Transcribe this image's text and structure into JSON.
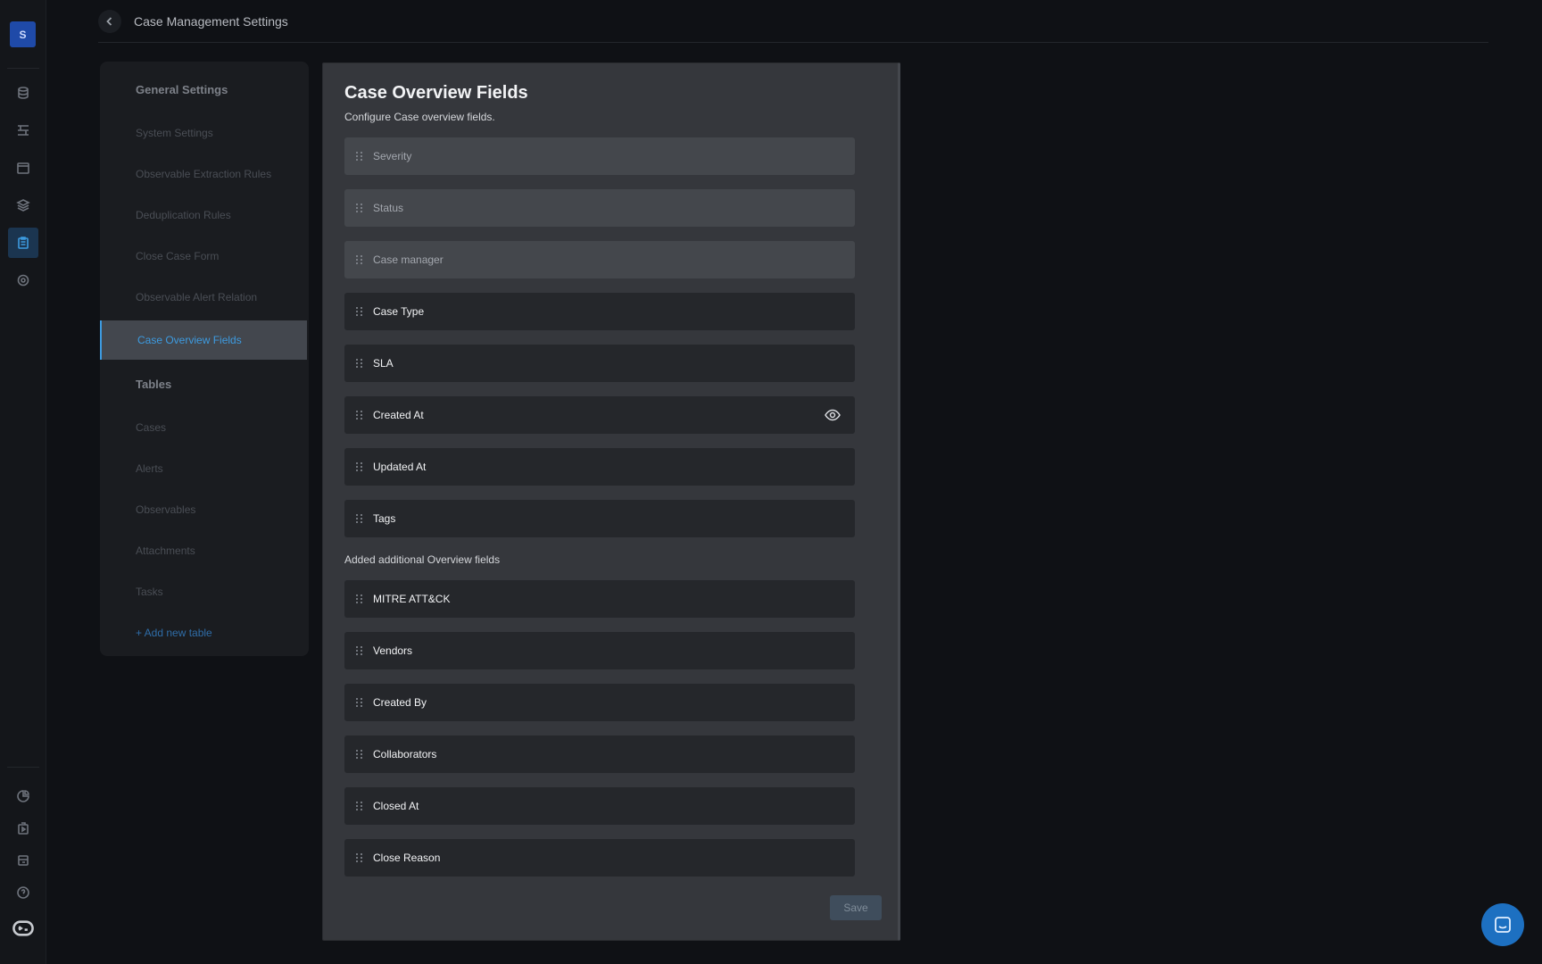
{
  "app": {
    "avatar_letter": "S",
    "accent_color": "#3d9be0"
  },
  "header": {
    "title": "Case Management Settings"
  },
  "nav": {
    "general_title": "General Settings",
    "general_items": [
      "System Settings",
      "Observable Extraction Rules",
      "Deduplication Rules",
      "Close Case Form",
      "Observable Alert Relation",
      "Case Overview Fields"
    ],
    "active_item": "Case Overview Fields",
    "tables_title": "Tables",
    "table_items": [
      "Cases",
      "Alerts",
      "Observables",
      "Attachments",
      "Tasks"
    ],
    "add_table": "+ Add new table"
  },
  "panel": {
    "title": "Case Overview Fields",
    "subtitle": "Configure Case overview fields.",
    "default_fields": [
      {
        "label": "Severity",
        "locked": true
      },
      {
        "label": "Status",
        "locked": true
      },
      {
        "label": "Case manager",
        "locked": true
      },
      {
        "label": "Case Type",
        "locked": false
      },
      {
        "label": "SLA",
        "locked": false
      },
      {
        "label": "Created At",
        "locked": false,
        "icon": "eye-icon"
      },
      {
        "label": "Updated At",
        "locked": false
      },
      {
        "label": "Tags",
        "locked": false
      }
    ],
    "additional_title": "Added additional Overview fields",
    "additional_fields": [
      "MITRE ATT&CK",
      "Vendors",
      "Created By",
      "Collaborators",
      "Closed At",
      "Close Reason"
    ],
    "save_label": "Save"
  }
}
